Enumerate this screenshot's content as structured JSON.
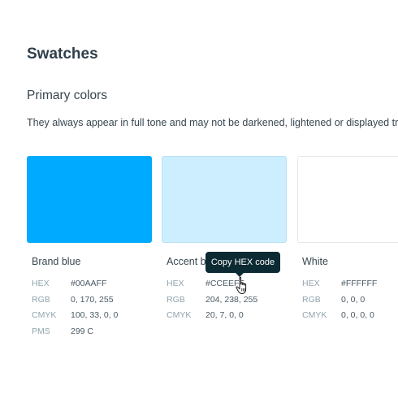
{
  "page": {
    "title": "Swatches",
    "section_title": "Primary colors",
    "description": "They always appear in full tone and may not be darkened, lightened or displayed tra"
  },
  "swatches": [
    {
      "name": "Brand blue",
      "color": "#00AAFF",
      "specs": [
        {
          "label": "HEX",
          "value": "#00AAFF"
        },
        {
          "label": "RGB",
          "value": "0, 170, 255"
        },
        {
          "label": "CMYK",
          "value": "100, 33, 0, 0"
        },
        {
          "label": "PMS",
          "value": "299 C"
        }
      ]
    },
    {
      "name": "Accent b",
      "color": "#CCEEFF",
      "specs": [
        {
          "label": "HEX",
          "value": "#CCEEFF"
        },
        {
          "label": "RGB",
          "value": "204, 238, 255"
        },
        {
          "label": "CMYK",
          "value": "20, 7, 0, 0"
        }
      ]
    },
    {
      "name": "White",
      "color": "#FFFFFF",
      "specs": [
        {
          "label": "HEX",
          "value": "#FFFFFF"
        },
        {
          "label": "RGB",
          "value": "0, 0, 0"
        },
        {
          "label": "CMYK",
          "value": "0, 0, 0, 0"
        }
      ]
    }
  ],
  "tooltip": {
    "text": "Copy HEX code"
  },
  "cursor": {
    "icon": "hand-pointer-icon"
  }
}
